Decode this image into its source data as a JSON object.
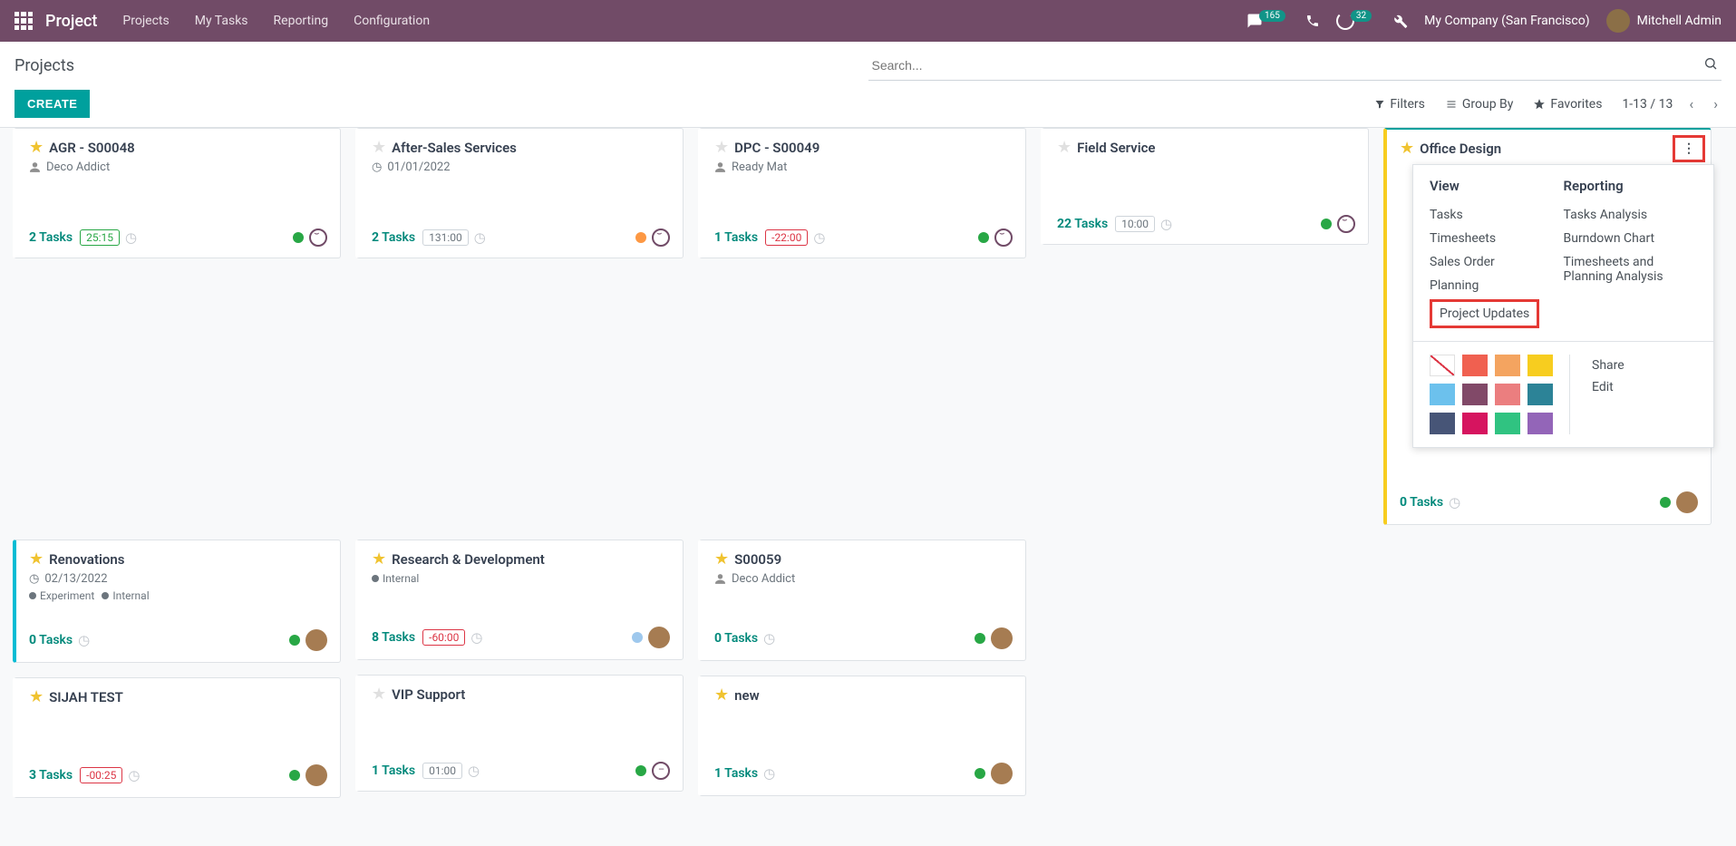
{
  "nav": {
    "brand": "Project",
    "items": [
      "Projects",
      "My Tasks",
      "Reporting",
      "Configuration"
    ],
    "msg_badge": "165",
    "clock_badge": "32",
    "company": "My Company (San Francisco)",
    "user": "Mitchell Admin"
  },
  "cp": {
    "title": "Projects",
    "search_placeholder": "Search...",
    "create": "CREATE",
    "filters": "Filters",
    "group_by": "Group By",
    "favorites": "Favorites",
    "pager": "1-13 / 13"
  },
  "cards": {
    "c1": {
      "title": "AGR - S00048",
      "partner": "Deco Addict",
      "tasks_n": "2",
      "tasks_l": " Tasks",
      "pill": "25:15"
    },
    "c2": {
      "title": "After-Sales Services",
      "date": "01/01/2022",
      "tasks_n": "2",
      "tasks_l": " Tasks",
      "pill": "131:00"
    },
    "c3": {
      "title": "DPC - S00049",
      "partner": "Ready Mat",
      "tasks_n": "1",
      "tasks_l": " Tasks",
      "pill": "-22:00"
    },
    "c4": {
      "title": "Field Service",
      "tasks_n": "22",
      "tasks_l": " Tasks",
      "pill": "10:00"
    },
    "c5": {
      "title": "Office Design",
      "tasks_n": "0",
      "tasks_l": " Tasks"
    },
    "c6": {
      "title": "Renovations",
      "date": "02/13/2022",
      "tag1": "Experiment",
      "tag2": "Internal",
      "tasks_n": "0",
      "tasks_l": " Tasks"
    },
    "c7": {
      "title": "Research & Development",
      "tag1": "Internal",
      "tasks_n": "8",
      "tasks_l": " Tasks",
      "pill": "-60:00"
    },
    "c8": {
      "title": "S00059",
      "partner": "Deco Addict",
      "tasks_n": "0",
      "tasks_l": " Tasks"
    },
    "c9": {
      "title": "SIJAH TEST",
      "tasks_n": "3",
      "tasks_l": " Tasks",
      "pill": "-00:25"
    },
    "c10": {
      "title": "VIP Support",
      "tasks_n": "1",
      "tasks_l": " Tasks",
      "pill": "01:00"
    },
    "c11": {
      "title": "new",
      "tasks_n": "1",
      "tasks_l": " Tasks"
    }
  },
  "menu": {
    "view_h": "View",
    "rep_h": "Reporting",
    "tasks": "Tasks",
    "timesheets": "Timesheets",
    "sales": "Sales Order",
    "planning": "Planning",
    "updates": "Project Updates",
    "ta": "Tasks Analysis",
    "bd": "Burndown Chart",
    "tpa": "Timesheets and Planning Analysis",
    "share": "Share",
    "edit": "Edit"
  },
  "colors": {
    "c1": "#f06050",
    "c2": "#f4a460",
    "c3": "#f7cd1f",
    "c4": "#6cc1ed",
    "c5": "#814968",
    "c6": "#eb7e7f",
    "c7": "#2c8397",
    "c8": "#475577",
    "c9": "#d6145f",
    "c10": "#30c381",
    "c11": "#9365b8"
  }
}
